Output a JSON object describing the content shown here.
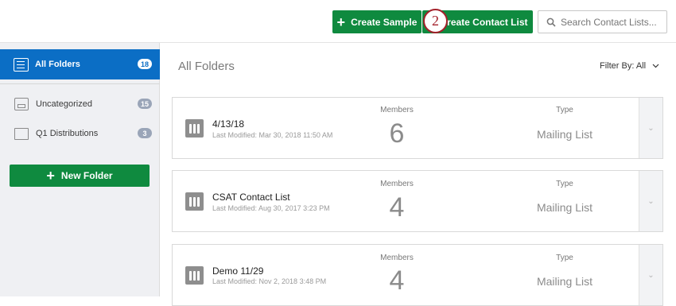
{
  "header": {
    "create_sample_label": "Create Sample",
    "create_contact_list_label": "Create Contact List",
    "step_marker": "2",
    "search_placeholder": "Search Contact Lists..."
  },
  "sidebar": {
    "active": {
      "label": "All Folders",
      "count": "18"
    },
    "items": [
      {
        "label": "Uncategorized",
        "count": "15",
        "icon": "drive-icon"
      },
      {
        "label": "Q1 Distributions",
        "count": "3",
        "icon": "folder-icon"
      }
    ],
    "new_folder_label": "New Folder"
  },
  "main": {
    "title": "All Folders",
    "filter_label": "Filter By: All",
    "lists": [
      {
        "name": "4/13/18",
        "modified": "Last Modified: Mar 30, 2018 11:50 AM",
        "members_label": "Members",
        "members": "6",
        "type_label": "Type",
        "type": "Mailing List"
      },
      {
        "name": "CSAT Contact List",
        "modified": "Last Modified: Aug 30, 2017 3:23 PM",
        "members_label": "Members",
        "members": "4",
        "type_label": "Type",
        "type": "Mailing List"
      },
      {
        "name": "Demo 11/29",
        "modified": "Last Modified: Nov 2, 2018 3:48 PM",
        "members_label": "Members",
        "members": "4",
        "type_label": "Type",
        "type": "Mailing List"
      }
    ]
  },
  "colors": {
    "accent_green": "#0f8a3f",
    "active_blue": "#0b6ec5",
    "step_red": "#a3202a"
  }
}
